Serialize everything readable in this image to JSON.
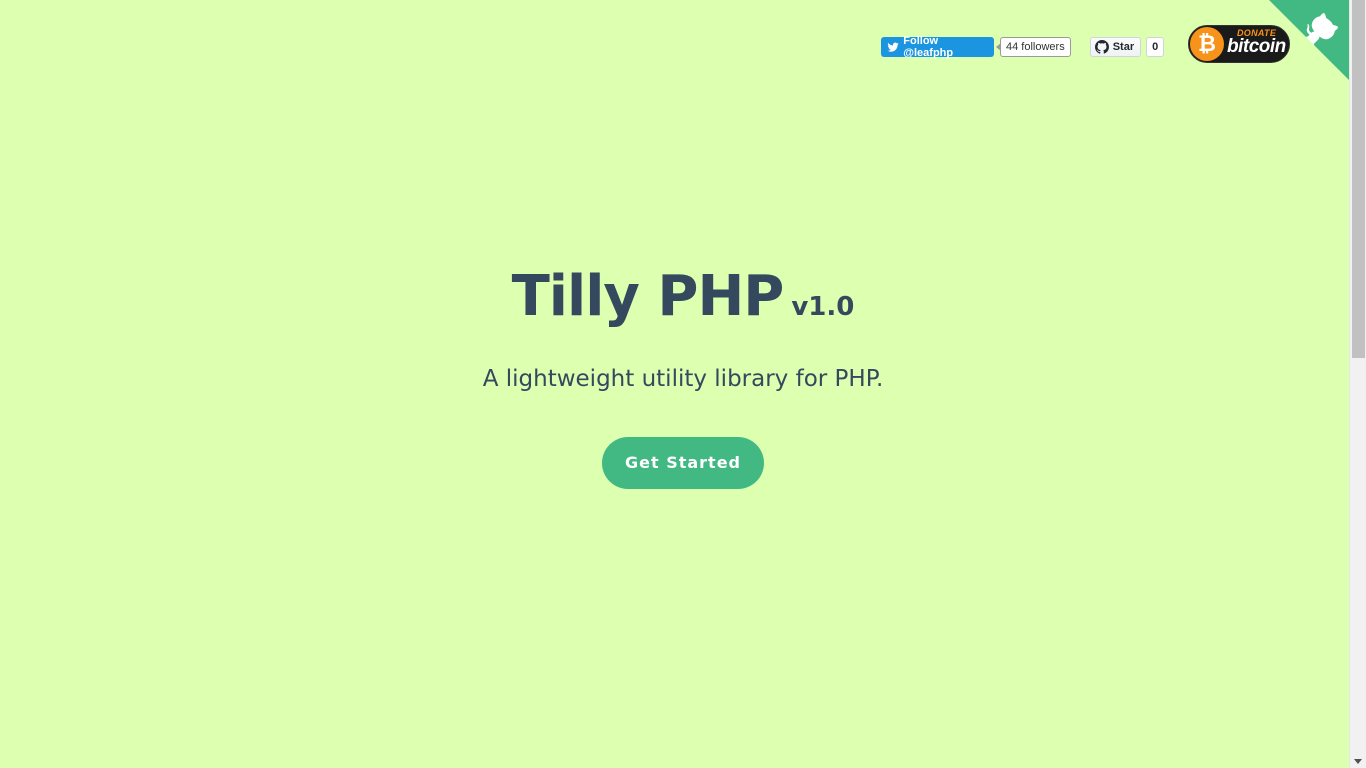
{
  "social": {
    "twitter_label": "Follow @leafphp",
    "twitter_count": "44 followers",
    "github_label": "Star",
    "github_count": "0"
  },
  "donate": {
    "top": "DONATE",
    "word": "bitcoin",
    "coin_glyph": "₿"
  },
  "hero": {
    "title": "Tilly PHP",
    "version": "v1.0",
    "tagline": "A lightweight utility library for PHP.",
    "cta_label": "Get Started"
  },
  "colors": {
    "background": "#dcffb0",
    "accent": "#42b983",
    "text": "#34495e",
    "twitter": "#1b95e0",
    "bitcoin": "#f7931a"
  },
  "icons": {
    "twitter": "twitter-bird-icon",
    "github": "github-octocat-icon",
    "corner": "github-corner-octocat-icon"
  }
}
